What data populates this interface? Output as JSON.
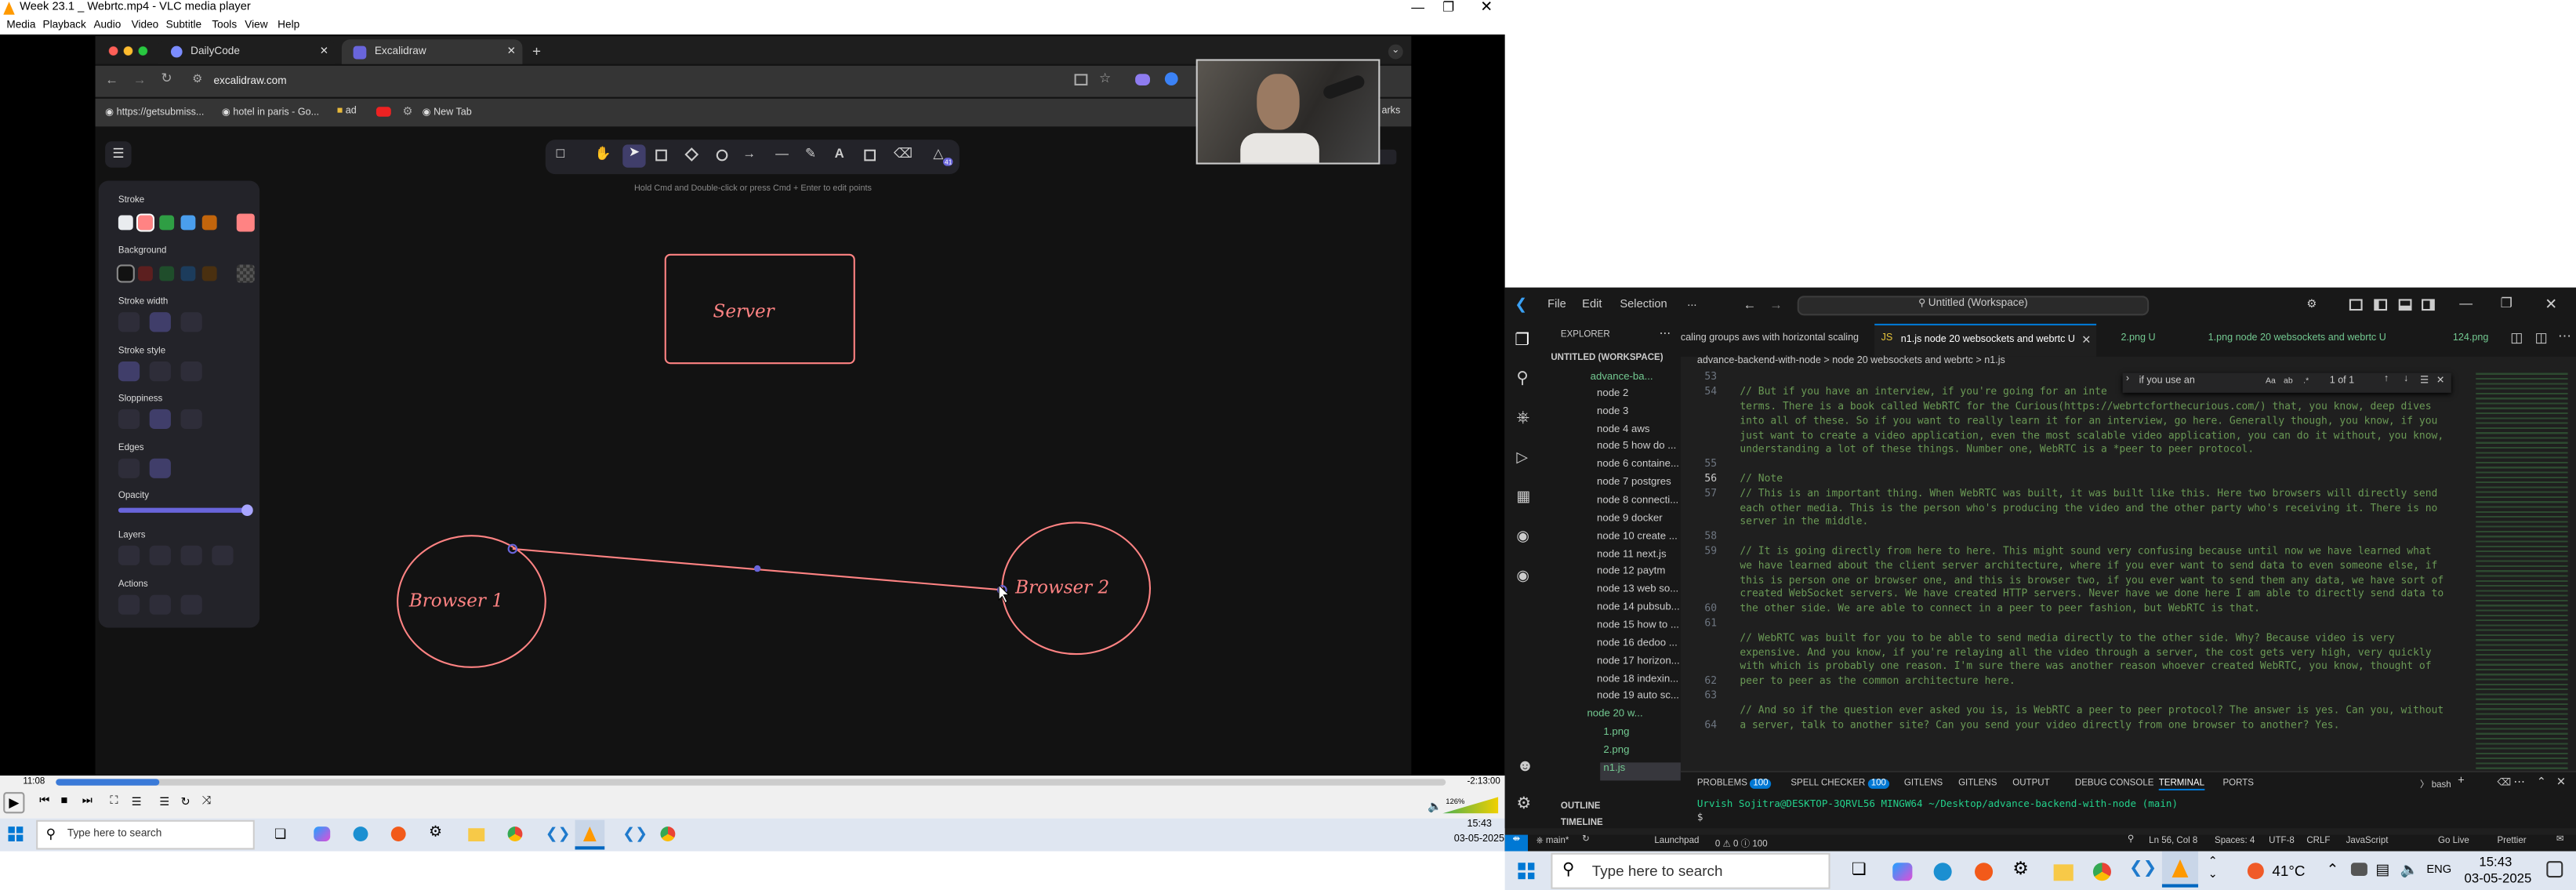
{
  "vlc": {
    "title": "Week 23.1 _ Webrtc.mp4 - VLC media player",
    "menu": [
      "Media",
      "Playback",
      "Audio",
      "Video",
      "Subtitle",
      "Tools",
      "View",
      "Help"
    ],
    "time_elapsed": "11:08",
    "time_remaining": "-2:13:00",
    "volume": "126%",
    "progress": 0.075
  },
  "chrome": {
    "tabs": [
      "DailyCode",
      "Excalidraw"
    ],
    "url": "excalidraw.com",
    "bookmarks": [
      "https://getsubmiss...",
      "hotel in paris - Go...",
      "ad",
      "New Tab"
    ],
    "bookmarks_end": "arks"
  },
  "excalidraw": {
    "hint": "Hold Cmd and Double-click or press Cmd + Enter to edit points",
    "panel": {
      "stroke": "Stroke",
      "background": "Background",
      "stroke_width": "Stroke width",
      "stroke_style": "Stroke style",
      "sloppiness": "Sloppiness",
      "edges": "Edges",
      "opacity": "Opacity",
      "layers": "Layers",
      "actions": "Actions"
    },
    "stroke_colors": [
      "#e9ecef",
      "#ff8383",
      "#2f9e44",
      "#4a9eed",
      "#c2650c",
      "#ff8383"
    ],
    "bg_colors": [
      "#121212",
      "#5c1f1f",
      "#1f4d2b",
      "#1c3c5c",
      "#4a3010"
    ],
    "badge": "41",
    "shapes": {
      "server": "Server",
      "browser1": "Browser 1",
      "browser2": "Browser 2"
    }
  },
  "taskbar_left": {
    "search": "Type here to search",
    "time": "15:43",
    "date": "03-05-2025"
  },
  "vscode": {
    "menu": [
      "File",
      "Edit",
      "Selection",
      "..."
    ],
    "search": "Untitled (Workspace)",
    "tabs": [
      "caling groups aws with horizontal scaling",
      "n1.js node 20 websockets and webrtc U",
      "2.png U",
      "1.png node 20 websockets and webrtc U",
      "124.png"
    ],
    "explorer": "EXPLORER",
    "workspace": "UNTITLED (WORKSPACE)",
    "root": "advance-ba...",
    "breadcrumb": [
      "advance-backend-with-node",
      ">",
      "node 20 websockets and webrtc",
      ">",
      "n1.js"
    ],
    "find": {
      "value": "if you use an",
      "count": "1 of 1"
    },
    "tree": [
      "node 2",
      "node 3",
      "node 4 aws",
      "node 5 how do ...",
      "node 6 containe...",
      "node 7 postgres",
      "node 8 connecti...",
      "node 9 docker",
      "node 10 create ...",
      "node 11 next.js",
      "node 12 paytm",
      "node 13 web so...",
      "node 14 pubsub...",
      "node 15 how to ...",
      "node 16 dedoo ...",
      "node 17 horizon...",
      "node 18 indexin...",
      "node 19 auto sc...",
      "node 20 w...",
      "1.png",
      "2.png",
      "n1.js"
    ],
    "line_numbers": [
      "53",
      "54",
      "",
      "",
      "",
      "55",
      "56",
      "57",
      "",
      "",
      "58",
      "59",
      "",
      "",
      "",
      "60",
      "61",
      "",
      "",
      "",
      "62",
      "63",
      "",
      "64"
    ],
    "code": [
      "",
      "// But if you have an interview, if you're going for an inte",
      "terms. There is a book called WebRTC for the Curious(https://webrtcforthecurious.com/) that, you know, deep dives",
      "into all of these. So if you want to really learn it for an interview, go here. Generally though, you know, if you",
      "just want to create a video application, even the most scalable video application, you can do it without, you know,",
      "understanding a lot of these things. Number one, WebRTC is a *peer to peer protocol.",
      "",
      "// Note",
      "// This is an important thing. When WebRTC was built, it was built like this. Here two browsers will directly send",
      "each other media. This is the person who's producing the video and the other party who's receiving it. There is no",
      "server in the middle.",
      "",
      "// It is going directly from here to here. This might sound very confusing because until now we have learned what",
      "we have learned about the client server architecture, where if you ever want to send data to even someone else, if",
      "this is person one or browser one, and this is browser two, if you ever want to send them any data, we have sort of",
      "created WebSocket servers. We have created HTTP servers. Never have we done here I am able to directly send data to",
      "the other side. We are able to connect in a peer to peer fashion, but WebRTC is that.",
      "",
      "// WebRTC was built for you to be able to send media directly to the other side. Why? Because video is very",
      "expensive. And you know, if you're relaying all the video through a server, the cost gets very high, very quickly",
      "with which is probably one reason. I'm sure there was another reason whoever created WebRTC, you know, thought of",
      "peer to peer as the common architecture here.",
      "",
      "// And so if the question ever asked you is, is WebRTC a peer to peer protocol? The answer is yes. Can you, without",
      "a server, talk to another site? Can you send your video directly from one browser to another? Yes."
    ],
    "panel_tabs": [
      "PROBLEMS",
      "SPELL CHECKER",
      "GITLENS",
      "GITLENS",
      "OUTPUT",
      "DEBUG CONSOLE",
      "TERMINAL",
      "PORTS"
    ],
    "problems_count": "100",
    "spell_count": "100",
    "terminal": "Urvish Sojitra@DESKTOP-3QRVL56 MINGW64 ~/Desktop/advance-backend-with-node (main)",
    "terminal_prompt": "$",
    "shell": "bash",
    "outline": "OUTLINE",
    "timeline": "TIMELINE",
    "status": {
      "branch": "main*",
      "launchpad": "Launchpad",
      "counts": "0 ⚠ 0 ⓘ 100",
      "position": "Ln 56, Col 8",
      "spaces": "Spaces: 4",
      "encoding": "UTF-8",
      "eol": "CRLF",
      "lang": "JavaScript",
      "golive": "Go Live",
      "prettier": "Prettier"
    }
  },
  "taskbar_right": {
    "search": "Type here to search",
    "weather": "41°C",
    "lang": "ENG",
    "time": "15:43",
    "date": "03-05-2025"
  }
}
